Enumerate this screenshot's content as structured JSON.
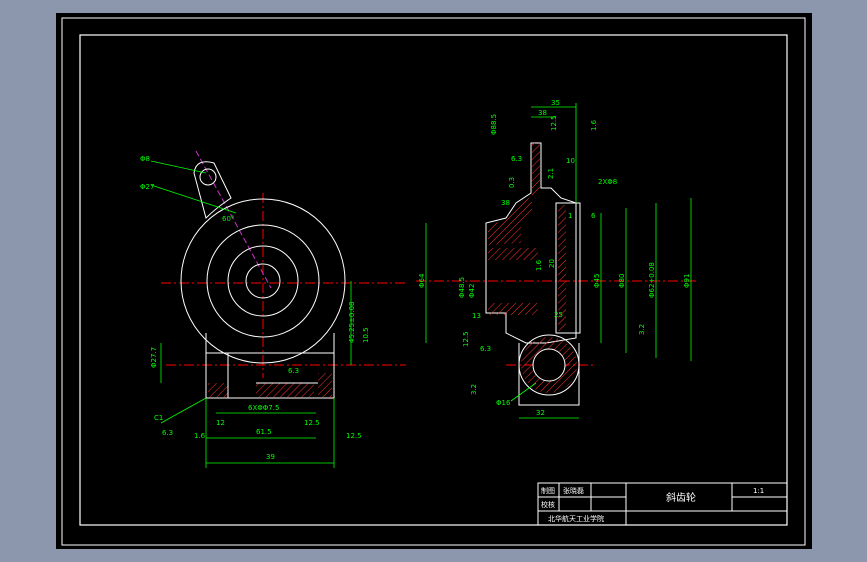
{
  "drawing": {
    "colors": {
      "background": "#000000",
      "outline": "#ffffff",
      "dimension": "#00ff00",
      "centerline": "#ff0000",
      "hatch": "#ff3030",
      "section_line": "#cc33cc"
    }
  },
  "front_view": {
    "labels": {
      "hole_small": "Φ8",
      "hole_large": "Φ27",
      "angle": "60°",
      "height_right": "45.25±0.08",
      "height_right_sub": "10.5",
      "height_left": "Φ27.7",
      "bottom_dims": "6.3",
      "slot": "6XΦΦ7.5",
      "chamfer": "C1",
      "roughness_a": "6.3",
      "dim_12": "12",
      "dim_61": "61.5",
      "dim_top_right": "12.5",
      "roughness_b": "1.6",
      "roughness_c": "12.5",
      "dim_total": "39"
    }
  },
  "side_view": {
    "labels": {
      "top_width": "35",
      "top_dim_a": "38",
      "top_rough": "12.5",
      "top_rough2": "1.6",
      "left_top": "Φ88.5",
      "left_mid": "6.3",
      "left_mid2": "0.3",
      "dim_10": "10",
      "dim_r1": "2.1",
      "dim_2x": "2XΦ8",
      "dim_38": "38",
      "dim_1": "1",
      "dim_6": "6",
      "left_dia": "Φ64",
      "left_inner": "Φ48.5",
      "left_inner_b": "Φ42",
      "rough_mid": "1.6",
      "dim_20": "20",
      "right_1": "Φ45",
      "right_2": "Φ80",
      "right_3": "Φ62+0.08",
      "right_4": "Φ91",
      "rough_right": "3.2",
      "dim_13": "13",
      "rough_lower": "12.5",
      "dim_25": "25",
      "dim_6b": "6.3",
      "bore": "Φ16",
      "rough_bottom": "3.2",
      "dim_bottom": "32"
    }
  },
  "title_block": {
    "draw_label": "制图",
    "draw_name": "张晓磊",
    "check_label": "校核",
    "part_name": "斜齿轮",
    "scale": "1:1",
    "school": "北华航天工业学院"
  }
}
